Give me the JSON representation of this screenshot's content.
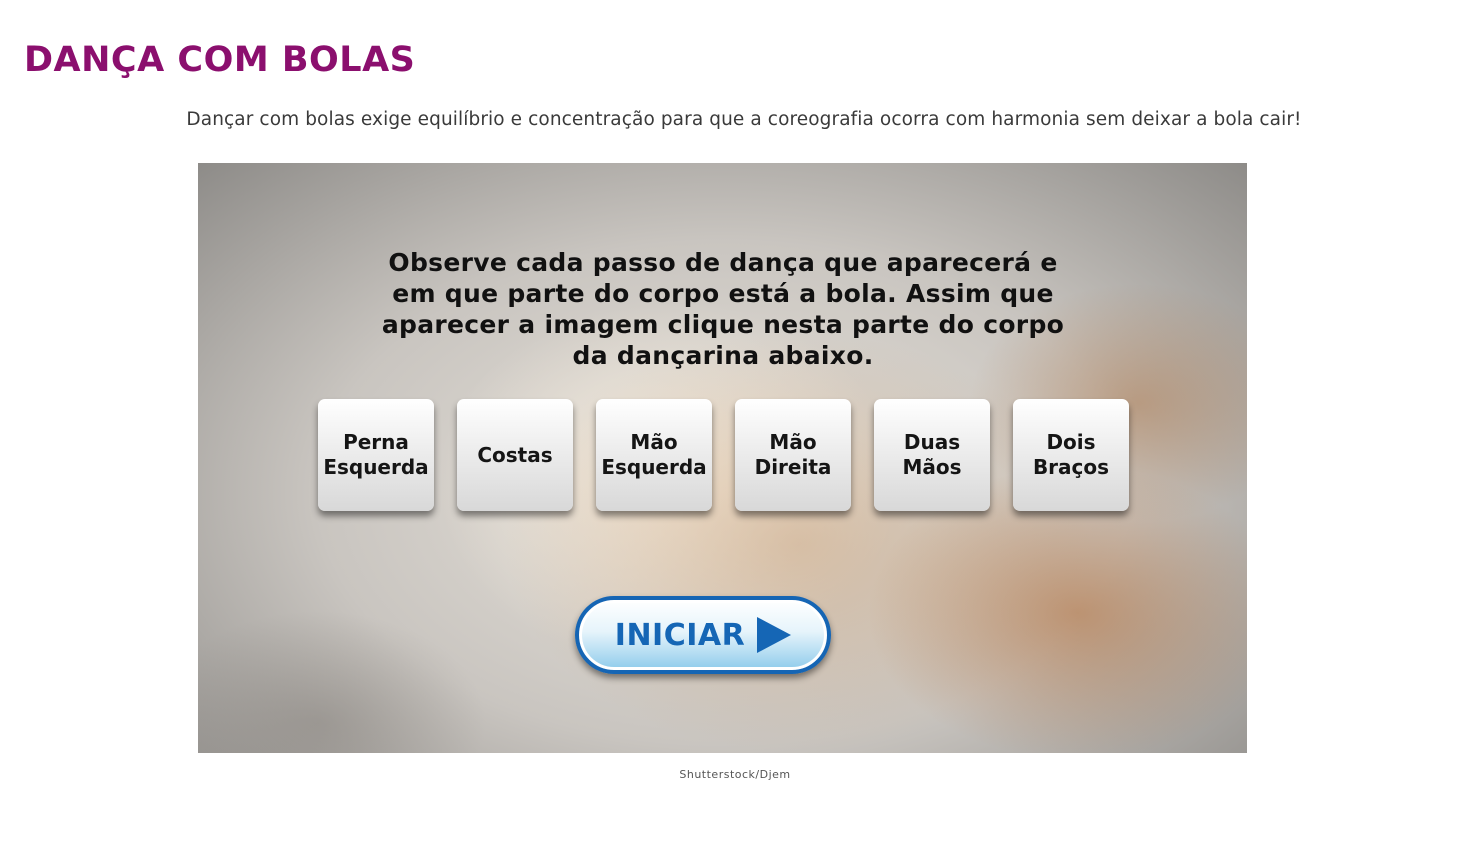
{
  "page": {
    "title": "DANÇA COM BOLAS",
    "intro": "Dançar com bolas exige equilíbrio e concentração para que a coreografia ocorra com harmonia sem deixar a bola cair!",
    "credit": "Shutterstock/Djem"
  },
  "game": {
    "instructions": "Observe cada passo de dança que aparecerá e em que parte do corpo está a bola. Assim que aparecer a imagem clique nesta parte do corpo da dançarina abaixo.",
    "options": [
      "Perna\nEsquerda",
      "Costas",
      "Mão\nEsquerda",
      "Mão\nDireita",
      "Duas\nMãos",
      "Dois\nBraços"
    ],
    "start_label": "INICIAR",
    "start_icon": "play-arrow-icon",
    "colors": {
      "title": "#8b0f6e",
      "start_button_text": "#1566b5",
      "start_button_border": "#1565b4"
    }
  }
}
